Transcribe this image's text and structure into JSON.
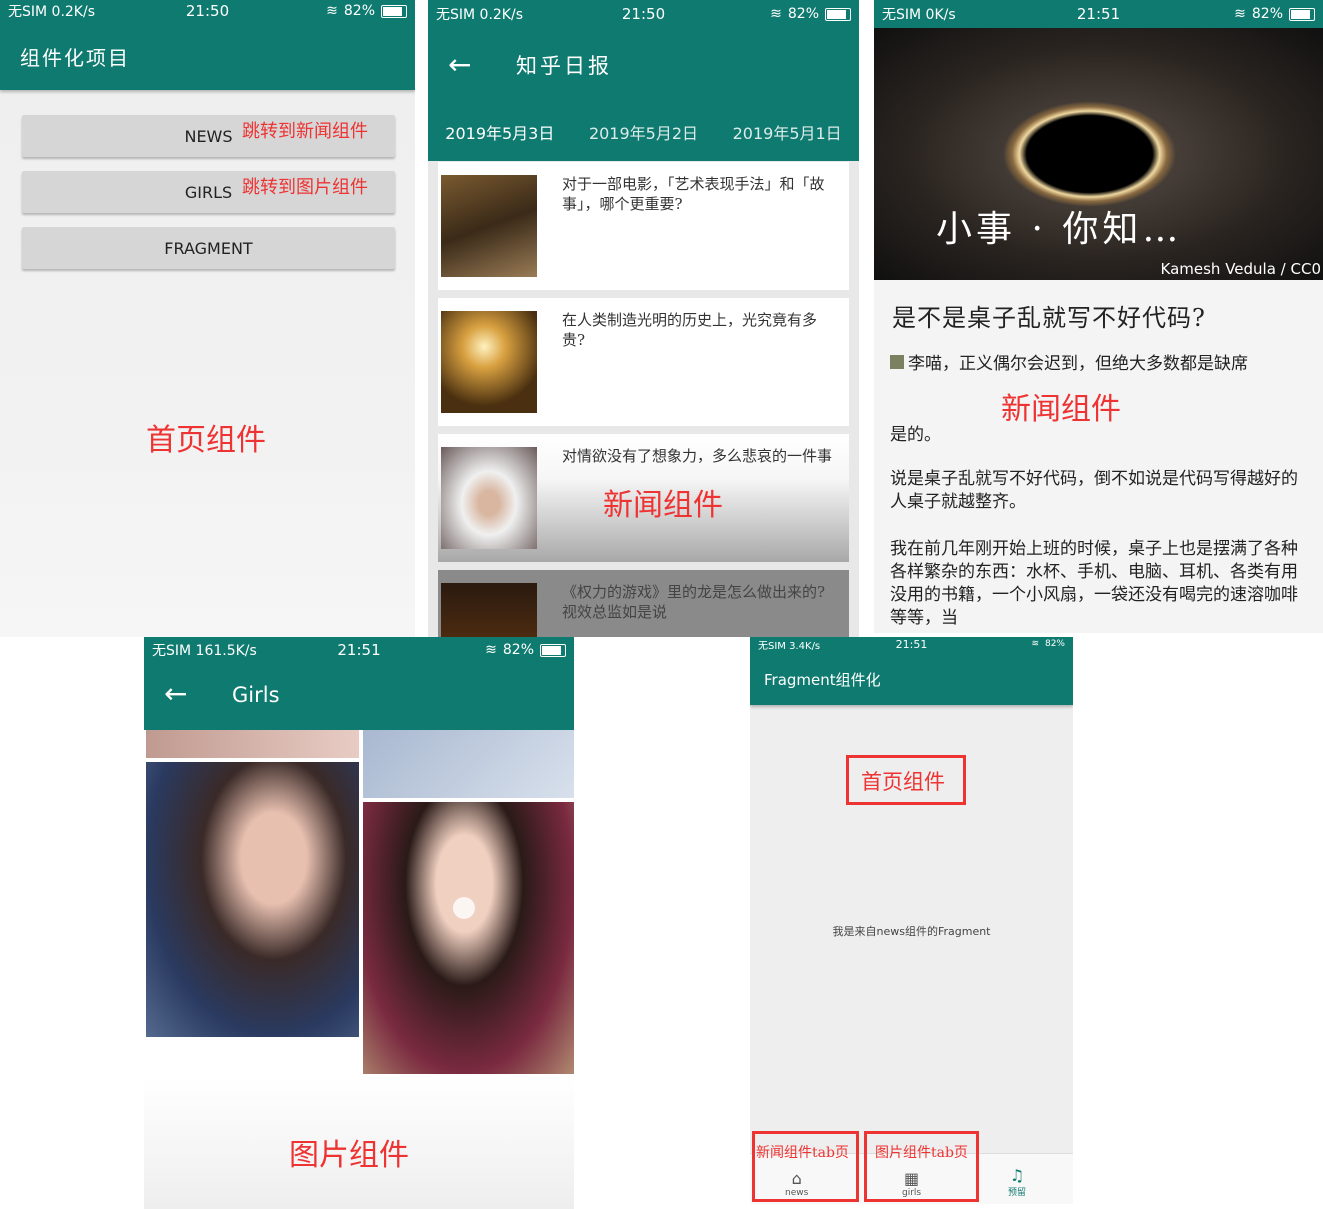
{
  "status_bars": {
    "p1": {
      "carrier": "无SIM 0.2K/s",
      "time": "21:50",
      "battery": "82%"
    },
    "p2": {
      "carrier": "无SIM 0.2K/s",
      "time": "21:50",
      "battery": "82%"
    },
    "p3": {
      "carrier": "无SIM 0K/s",
      "time": "21:51",
      "battery": "82%"
    },
    "p4": {
      "carrier": "无SIM 161.5K/s",
      "time": "21:51",
      "battery": "82%"
    },
    "p5": {
      "carrier": "无SIM 3.4K/s",
      "time": "21:51",
      "battery": "82%"
    }
  },
  "home": {
    "title": "组件化项目",
    "buttons": [
      {
        "label": "NEWS",
        "annotation": "跳转到新闻组件"
      },
      {
        "label": "GIRLS",
        "annotation": "跳转到图片组件"
      },
      {
        "label": "FRAGMENT",
        "annotation": ""
      }
    ],
    "caption": "首页组件"
  },
  "zhihu": {
    "title": "知乎日报",
    "tabs": [
      "2019年5月3日",
      "2019年5月2日",
      "2019年5月1日"
    ],
    "items": [
      {
        "title": "对于一部电影，「艺术表现手法」和「故事」，哪个更重要?"
      },
      {
        "title": "在人类制造光明的历史上，光究竟有多贵?"
      },
      {
        "title": "对情欲没有了想象力，多么悲哀的一件事"
      },
      {
        "title": "《权力的游戏》里的龙是怎么做出来的? 视效总监如是说"
      }
    ],
    "caption": "新闻组件"
  },
  "article": {
    "hero_text": "小事 · 你知…",
    "credit": "Kamesh Vedula / CC0",
    "title": "是不是桌子乱就写不好代码?",
    "author_line": "李喵，正义偶尔会迟到，但绝大多数都是缺席",
    "p1": "是的。",
    "p2": "说是桌子乱就写不好代码，倒不如说是代码写得越好的人桌子就越整齐。",
    "p3": "我在前几年刚开始上班的时候，桌子上也是摆满了各种各样繁杂的东西：水杯、手机、电脑、耳机、各类有用没用的书籍，一个小风扇，一袋还没有喝完的速溶咖啡等等，当",
    "caption": "新闻组件"
  },
  "girls": {
    "title": "Girls",
    "caption": "图片组件"
  },
  "fragment": {
    "title": "Fragment组件化",
    "caption": "首页组件",
    "center_text": "我是来自news组件的Fragment",
    "tabs": [
      {
        "label": "news",
        "annotation": "新闻组件tab页",
        "icon": "home-icon"
      },
      {
        "label": "girls",
        "annotation": "图片组件tab页",
        "icon": "grid-icon"
      },
      {
        "label": "预留",
        "annotation": "",
        "icon": "bell-icon"
      }
    ]
  },
  "colors": {
    "primary": "#0f7b70",
    "annotation": "#e33333"
  }
}
